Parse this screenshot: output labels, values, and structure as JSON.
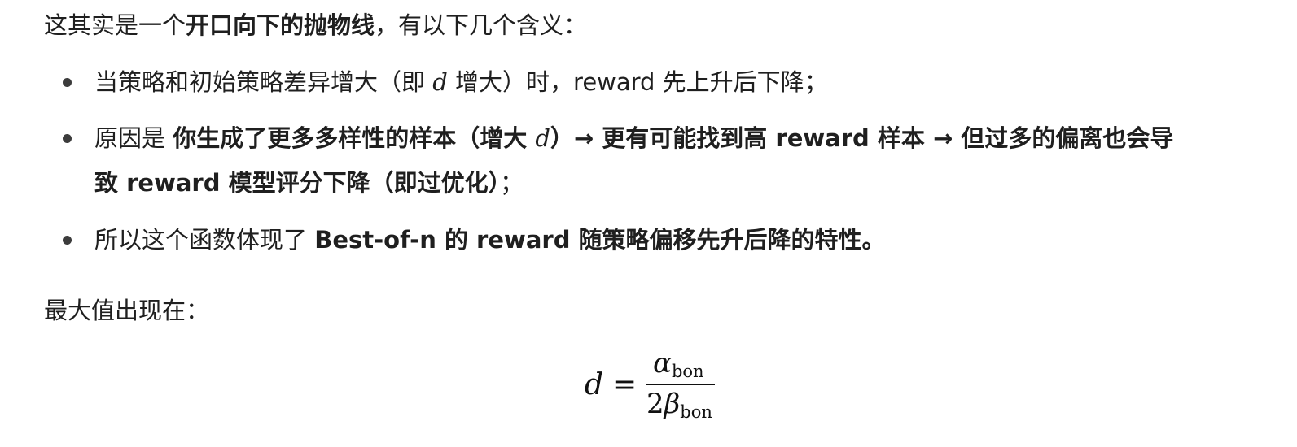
{
  "intro": {
    "prefix": "这其实是一个",
    "bold": "开口向下的抛物线",
    "suffix": "，有以下几个含义："
  },
  "bullets": [
    {
      "pre": "当策略和初始策略差异增大（即 ",
      "var": "d",
      "post": " 增大）时，reward 先上升后下降；"
    },
    {
      "pre": "原因是 ",
      "bold_a": "你生成了更多多样性的样本（增大 ",
      "var": "d",
      "bold_b": "）→ 更有可能找到高 reward 样本 → 但过多的偏离也会导",
      "bold_c": "致 reward 模型评分下降（即过优化）",
      "tail": "；"
    },
    {
      "pre": "所以这个函数体现了 ",
      "bold": "Best-of-n 的 reward 随策略偏移先升后降的特性。"
    }
  ],
  "max_label": "最大值出现在：",
  "formula": {
    "lhs": "d",
    "eq": "=",
    "num_symbol": "α",
    "num_sub": "bon",
    "den_coef": "2",
    "den_symbol": "β",
    "den_sub": "bon"
  }
}
